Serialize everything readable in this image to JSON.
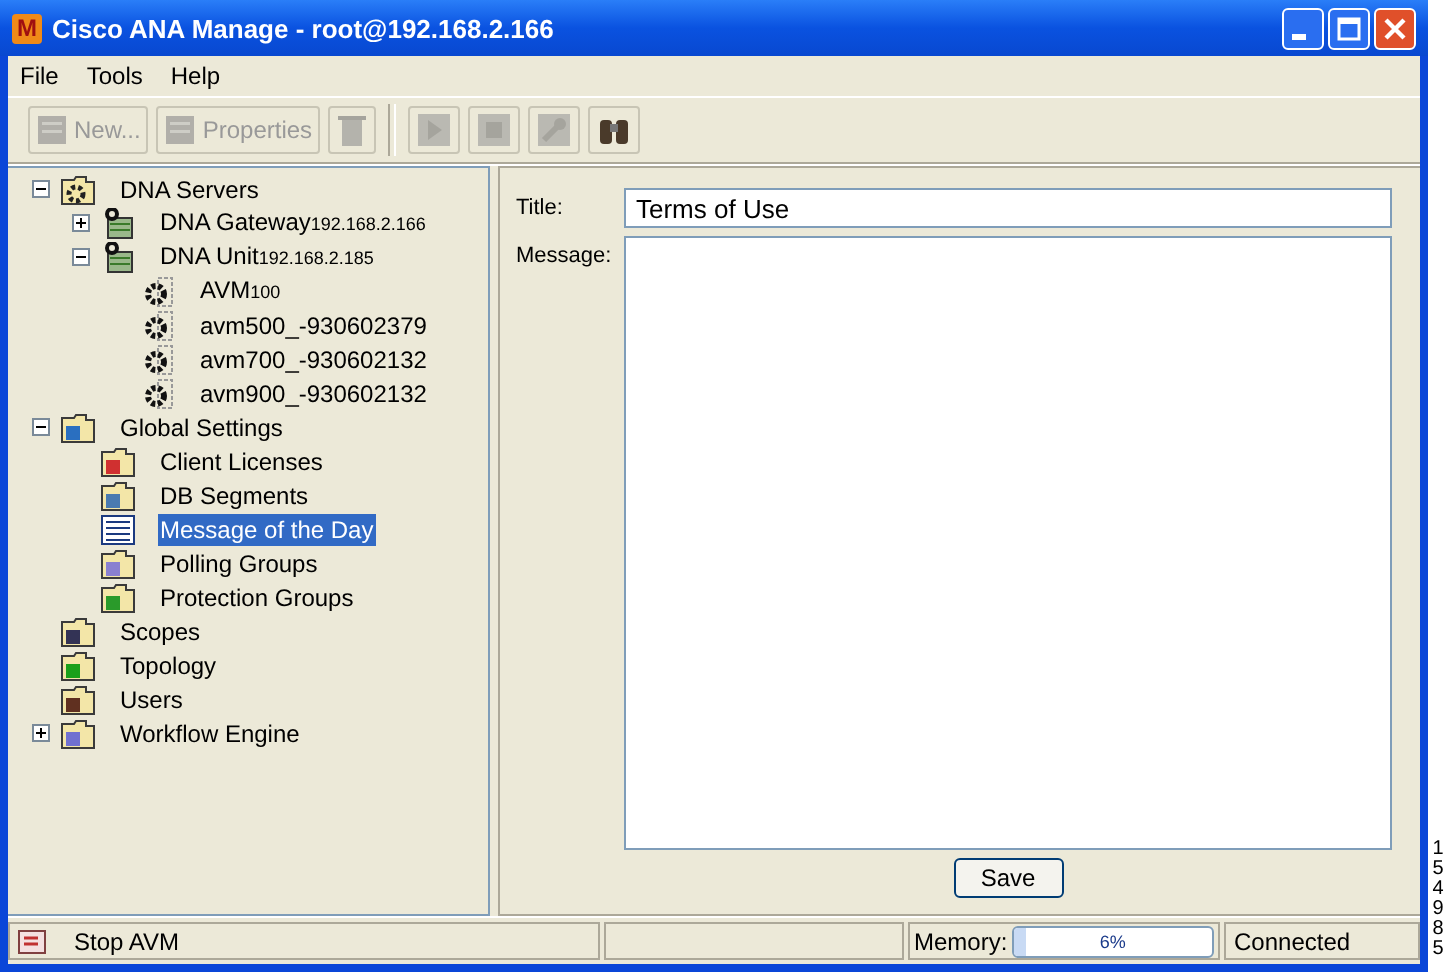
{
  "window": {
    "title": "Cisco ANA Manage - root@192.168.2.166",
    "logo": "M"
  },
  "menu": [
    "File",
    "Tools",
    "Help"
  ],
  "toolbar": [
    {
      "kind": "new",
      "label": "New...",
      "disabled": true
    },
    {
      "kind": "properties",
      "label": "Properties",
      "disabled": true
    },
    {
      "kind": "delete",
      "disabled": true
    },
    {
      "kind": "play",
      "disabled": true
    },
    {
      "kind": "stop",
      "disabled": true
    },
    {
      "kind": "wrench",
      "disabled": true
    },
    {
      "kind": "find",
      "disabled": false
    }
  ],
  "tree": [
    {
      "label": "DNA Servers",
      "kind": "servers",
      "expanded": true,
      "selected": false,
      "children": [
        {
          "label": "DNA Gateway",
          "sub": "192.168.2.166",
          "kind": "gateway",
          "expanded": false,
          "selected": false
        },
        {
          "label": "DNA Unit",
          "sub": "192.168.2.185",
          "kind": "unit",
          "expanded": true,
          "selected": false,
          "children": [
            {
              "label": "AVM",
              "sub": "100",
              "kind": "avm",
              "selected": false
            },
            {
              "label": "avm500_-930602379",
              "kind": "avm",
              "selected": false
            },
            {
              "label": "avm700_-930602132",
              "kind": "avm",
              "selected": false
            },
            {
              "label": "avm900_-930602132",
              "kind": "avm",
              "selected": false
            }
          ]
        }
      ]
    },
    {
      "label": "Global Settings",
      "kind": "settings",
      "expanded": true,
      "selected": false,
      "children": [
        {
          "label": "Client Licenses",
          "kind": "licenses",
          "selected": false
        },
        {
          "label": "DB Segments",
          "kind": "segments",
          "selected": false
        },
        {
          "label": "Message of the Day",
          "kind": "message",
          "selected": true
        },
        {
          "label": "Polling Groups",
          "kind": "polling",
          "selected": false
        },
        {
          "label": "Protection Groups",
          "kind": "protection",
          "selected": false
        }
      ]
    },
    {
      "label": "Scopes",
      "kind": "scopes",
      "selected": false
    },
    {
      "label": "Topology",
      "kind": "topology",
      "selected": false
    },
    {
      "label": "Users",
      "kind": "users",
      "selected": false
    },
    {
      "label": "Workflow Engine",
      "kind": "workflow",
      "expanded": false,
      "selected": false
    }
  ],
  "form": {
    "title_label": "Title:",
    "title_value": "Terms of Use",
    "message_label": "Message:",
    "save": "Save"
  },
  "status_bar": {
    "message": "Stop AVM",
    "memory_label": "Memory:",
    "memory": {
      "level": 0.06,
      "reading": "6%"
    },
    "connection": "Connected"
  },
  "figure_number": "154985"
}
